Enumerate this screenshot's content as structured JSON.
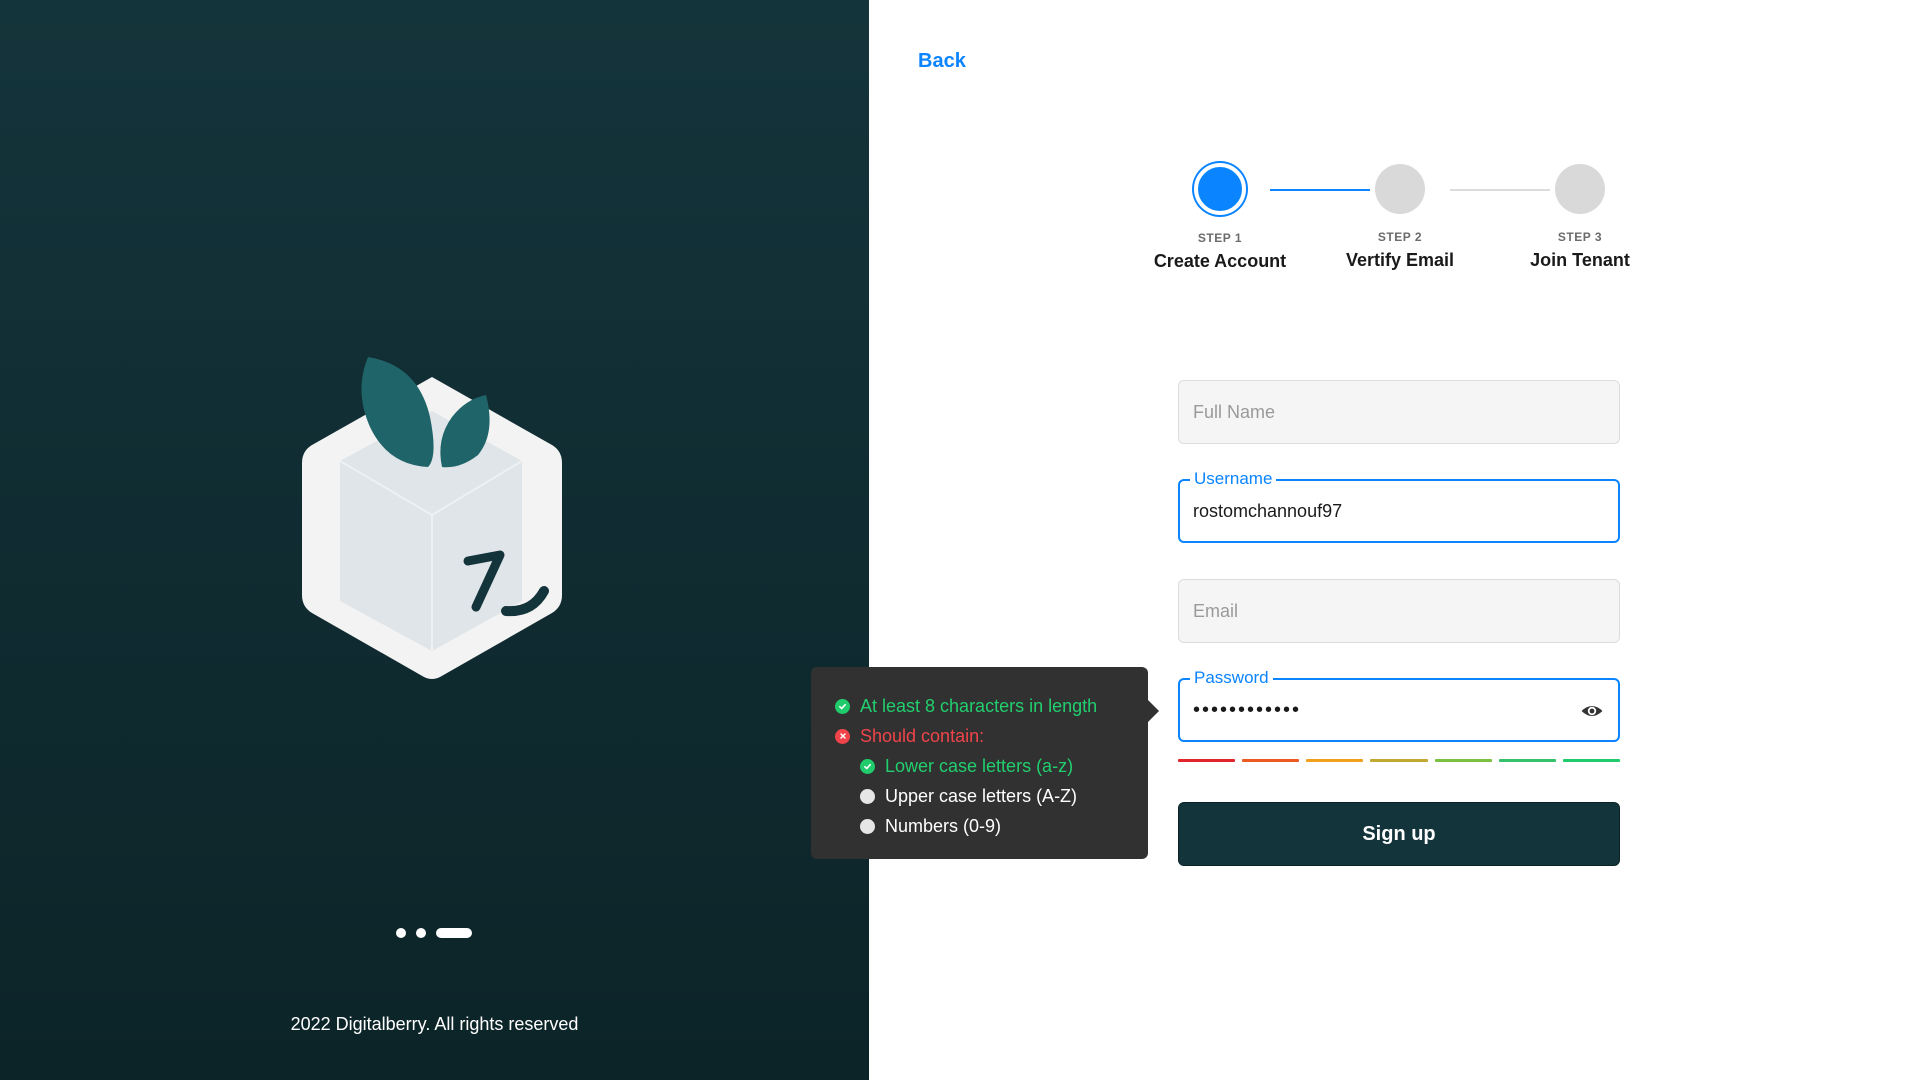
{
  "brand": {
    "copyright": "2022 Digitalberry. All rights reserved",
    "carousel": {
      "count": 3,
      "active_index": 2
    }
  },
  "nav": {
    "back_label": "Back"
  },
  "stepper": {
    "steps": [
      {
        "number_label": "STEP 1",
        "label": "Create Account",
        "state": "active"
      },
      {
        "number_label": "STEP 2",
        "label": "Vertify Email",
        "state": "pending"
      },
      {
        "number_label": "STEP 3",
        "label": "Join Tenant",
        "state": "pending"
      }
    ]
  },
  "form": {
    "full_name": {
      "placeholder": "Full Name",
      "value": ""
    },
    "username": {
      "label": "Username",
      "value": "rostomchannouf97"
    },
    "email": {
      "placeholder": "Email",
      "value": ""
    },
    "password": {
      "label": "Password",
      "value": "••••••••••••"
    },
    "strength_colors": [
      "#e0252b",
      "#ec5a22",
      "#f0a01d",
      "#c2a830",
      "#7bc140",
      "#35c06a",
      "#1fcb6b"
    ],
    "submit_label": "Sign up"
  },
  "password_rules": {
    "items": [
      {
        "text": "At least 8 characters in length",
        "status": "ok",
        "indent": false
      },
      {
        "text": "Should contain:",
        "status": "err",
        "indent": false
      },
      {
        "text": "Lower case letters (a-z)",
        "status": "ok",
        "indent": true
      },
      {
        "text": "Upper case letters (A-Z)",
        "status": "none",
        "indent": true
      },
      {
        "text": "Numbers (0-9)",
        "status": "none",
        "indent": true
      }
    ]
  },
  "colors": {
    "accent": "#0a84ff",
    "brand_dark": "#14343b",
    "success": "#1fcb6b",
    "error": "#f0444a"
  }
}
